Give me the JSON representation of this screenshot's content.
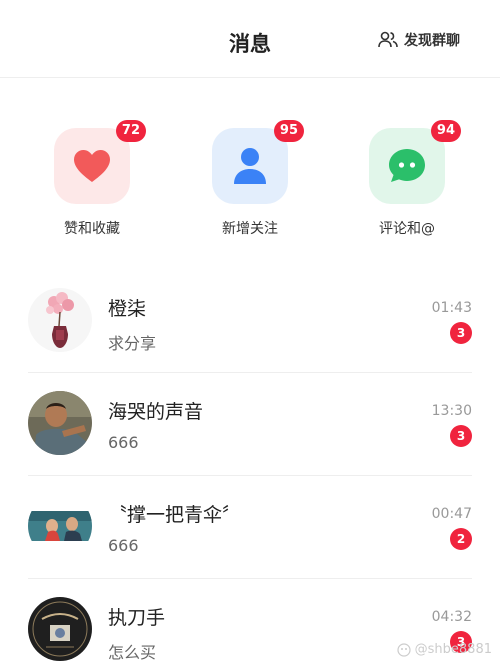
{
  "header": {
    "title": "消息",
    "discover_label": "发现群聊",
    "discover_icon": "group-icon"
  },
  "quick_actions": [
    {
      "label": "赞和收藏",
      "badge": "72",
      "icon": "heart-icon",
      "color": "#f25a5a",
      "bg": "#fde8e8"
    },
    {
      "label": "新增关注",
      "badge": "95",
      "icon": "person-icon",
      "color": "#3b82f6",
      "bg": "#e3eefc"
    },
    {
      "label": "评论和@",
      "badge": "94",
      "icon": "chat-bubble-icon",
      "color": "#2bbf6a",
      "bg": "#e1f6ea"
    }
  ],
  "conversations": [
    {
      "name": "橙柒",
      "message": "求分享",
      "time": "01:43",
      "unread": "3",
      "avatar": "flower-vase-avatar"
    },
    {
      "name": "海哭的声音",
      "message": "666",
      "time": "13:30",
      "unread": "3",
      "avatar": "person-photo-avatar"
    },
    {
      "name": "〝撑一把青伞〞",
      "message": "666",
      "time": "00:47",
      "unread": "2",
      "avatar": "movie-still-avatar"
    },
    {
      "name": "执刀手",
      "message": "怎么买",
      "time": "04:32",
      "unread": "3",
      "avatar": "layover-logo-avatar"
    }
  ],
  "watermark": "@shbe8881",
  "accent_color": "#f0243e"
}
